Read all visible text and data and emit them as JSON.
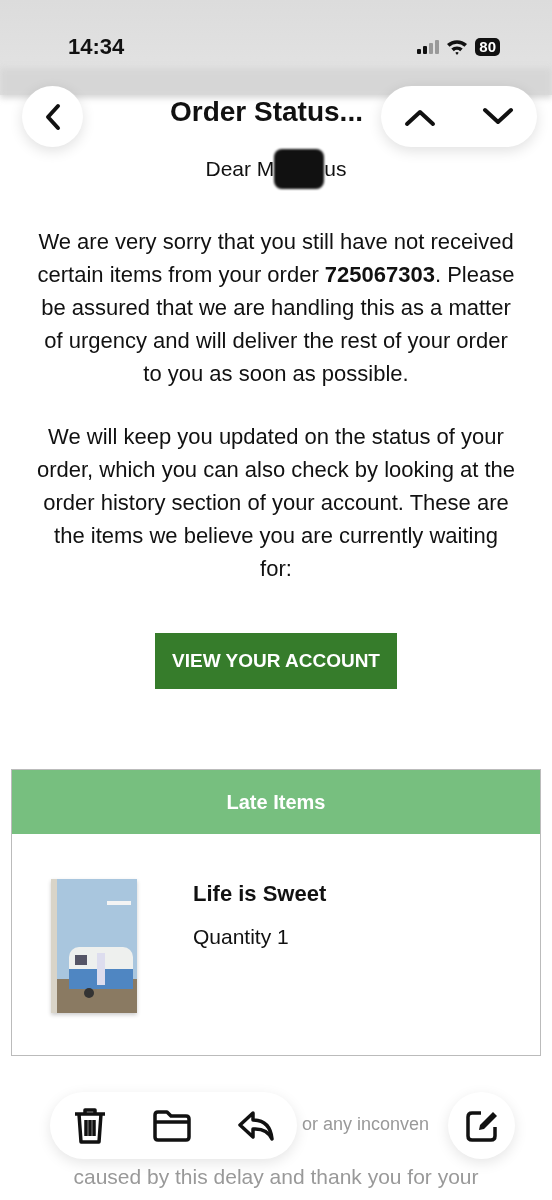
{
  "status_bar": {
    "time": "14:34",
    "battery": "80"
  },
  "header": {
    "title": "Order Status..."
  },
  "email": {
    "greeting": "Dear M",
    "greeting_end": "us",
    "paragraphs": [
      "We are very sorry that you still have not received certain items from your order **725067303**. Please be assured that we are handling this as a matter of urgency and will deliver the rest of your order to you as soon as possible.",
      "We will keep you updated on the status of your order, which you can also check by looking at the order history section of your account. These are the items we believe you are currently waiting for:"
    ],
    "button": "VIEW YOUR ACCOUNT",
    "late_items": {
      "title": "Late Items",
      "items": [
        {
          "name": "Life is Sweet",
          "quantity": "Quantity 1",
          "kind": "picture"
        }
      ]
    },
    "footer_lines": [
      "or any inconven",
      "caused by this delay and thank you for your"
    ]
  }
}
